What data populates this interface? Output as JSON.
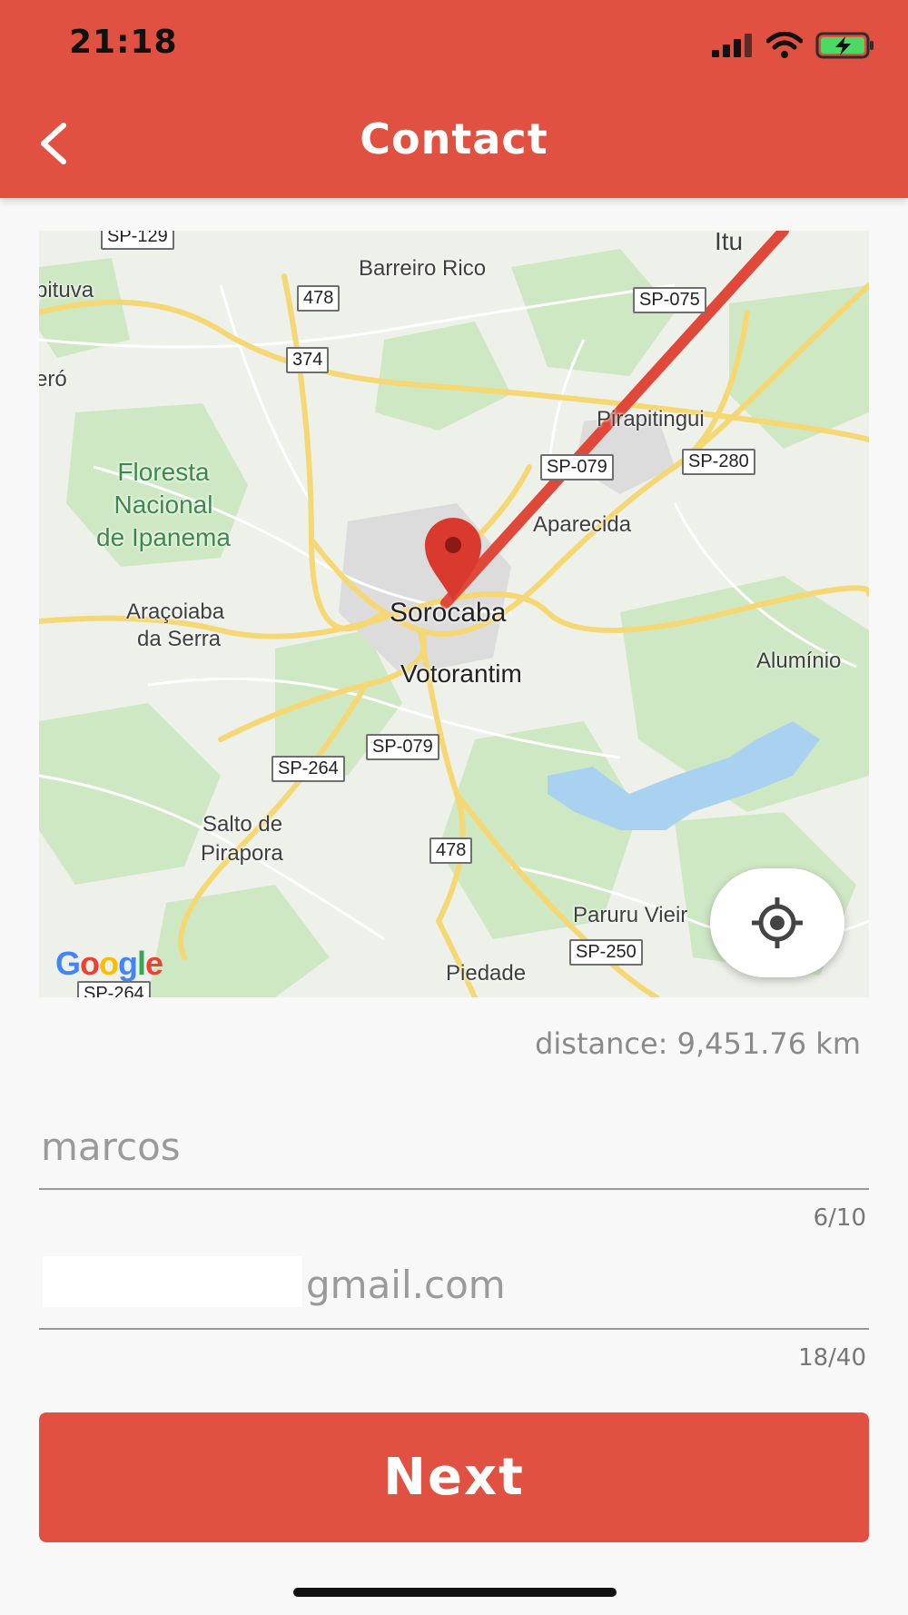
{
  "status": {
    "time": "21:18"
  },
  "header": {
    "title": "Contact",
    "back_icon": "chevron-left-icon"
  },
  "colors": {
    "accent": "#e05141"
  },
  "map": {
    "places": {
      "barreiro_rico": "Barreiro Rico",
      "itu": "Itu",
      "pirapitingui": "Pirapitingui",
      "aparecida": "Aparecida",
      "sorocaba": "Sorocaba",
      "votorantim": "Votorantim",
      "aluminio": "Alumínio",
      "aracoiaba_1": "Araçoiaba",
      "aracoiaba_2": "da Serra",
      "salto_1": "Salto de",
      "salto_2": "Pirapora",
      "paruru": "Paruru Vieir",
      "piedade": "Piedade",
      "pituva": "pituva",
      "ero": "eró",
      "floresta_1": "Floresta",
      "floresta_2": "Nacional",
      "floresta_3": "de Ipanema"
    },
    "roads": {
      "sp129": "SP-129",
      "r478a": "478",
      "r374": "374",
      "sp075": "SP-075",
      "sp079a": "SP-079",
      "sp280": "SP-280",
      "sp079b": "SP-079",
      "sp264a": "SP-264",
      "r478b": "478",
      "sp250": "SP-250",
      "sp264b": "SP-264"
    },
    "attribution": "Google",
    "locate_icon": "crosshair-icon"
  },
  "distance": "distance: 9,451.76 km",
  "form": {
    "name_value": "marcos",
    "name_counter": "6/10",
    "email_value": "gmail.com",
    "email_counter": "18/40"
  },
  "next_label": "Next"
}
